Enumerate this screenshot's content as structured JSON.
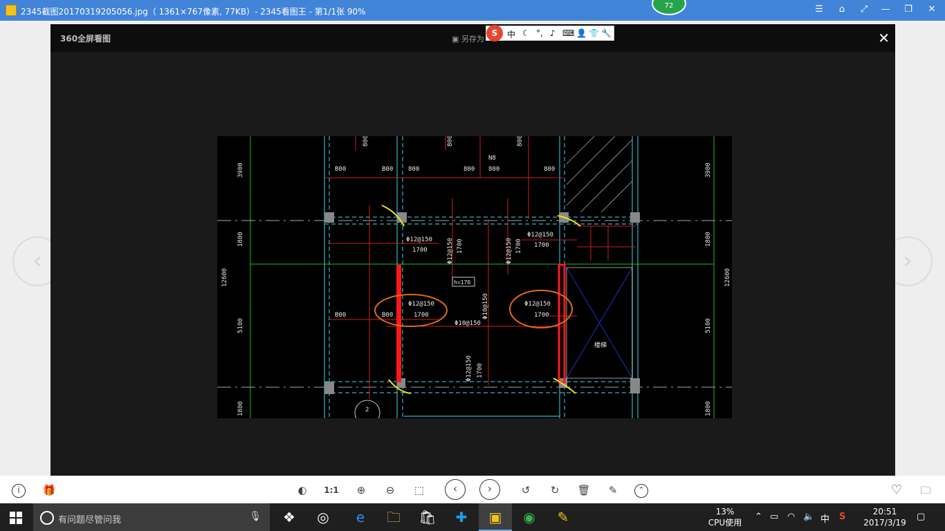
{
  "window": {
    "title": "2345截图20170319205056.jpg（ 1361×767像素, 77KB）- 2345看图王 - 第1/1张 90%",
    "badge": "72",
    "buttons": {
      "menu": "☰",
      "skin": "⌂",
      "fullscreen": "⤢",
      "minimize": "—",
      "restore": "❐",
      "close": "✕"
    }
  },
  "viewer": {
    "brand": "360全屏看图",
    "save_as": "另存为",
    "close": "✕"
  },
  "ime": {
    "logo": "S",
    "mode": "中",
    "items": [
      "☾",
      "°,",
      "♪",
      "⌨",
      "👤",
      "👕",
      "🔧"
    ]
  },
  "drawing": {
    "dims_left": [
      "3900",
      "1800",
      "12600",
      "5100",
      "1800"
    ],
    "dims_right": [
      "3900",
      "1800",
      "12600",
      "5100",
      "1800"
    ],
    "top_labels": [
      "800",
      "800",
      "800",
      "800"
    ],
    "row_labels": [
      "B00",
      "B00",
      "800",
      "800",
      "800",
      "800"
    ],
    "n_label": "N8",
    "rebar_1": "Φ12@150",
    "rebar_1_len": "1700",
    "rebar_2": "Φ12@150",
    "rebar_2_len": "1700",
    "rebar_3": "Φ12@150",
    "rebar_3_len": "1700",
    "rebar_4": "Φ12@150",
    "rebar_4_len": "1700",
    "rebar_mid": "Φ10@150",
    "rebar_v1": "Φ12@150",
    "rebar_v1_len": "1700",
    "rebar_v2": "Φ12@150",
    "rebar_v2_len": "1700",
    "rebar_v3": "Φ10@150",
    "rebar_v4": "Φ12@150",
    "rebar_v4_len": "1700",
    "slab": "h=170",
    "b00": "B00",
    "shaft": "楼梯",
    "axis_mark": "2"
  },
  "toolbar": {
    "info": "i",
    "gift": "🎁",
    "actual_size": "1:1",
    "zoom_in": "⊕",
    "zoom_out": "⊖",
    "prev": "‹",
    "next": "›",
    "rotate_left": "↺",
    "rotate_right": "↻",
    "delete": "🗑",
    "edit": "✎",
    "up": "⌃",
    "favorite": "♡",
    "folder": "🗀"
  },
  "taskbar": {
    "search_placeholder": "有问题尽管问我",
    "cpu_percent": "13%",
    "cpu_label": "CPU使用",
    "ime_mode": "中",
    "time": "20:51",
    "date": "2017/3/19"
  },
  "colors": {
    "titlebar": "#4284d8",
    "viewer": "#1a1a1a",
    "taskbar": "#1f1f1f"
  }
}
